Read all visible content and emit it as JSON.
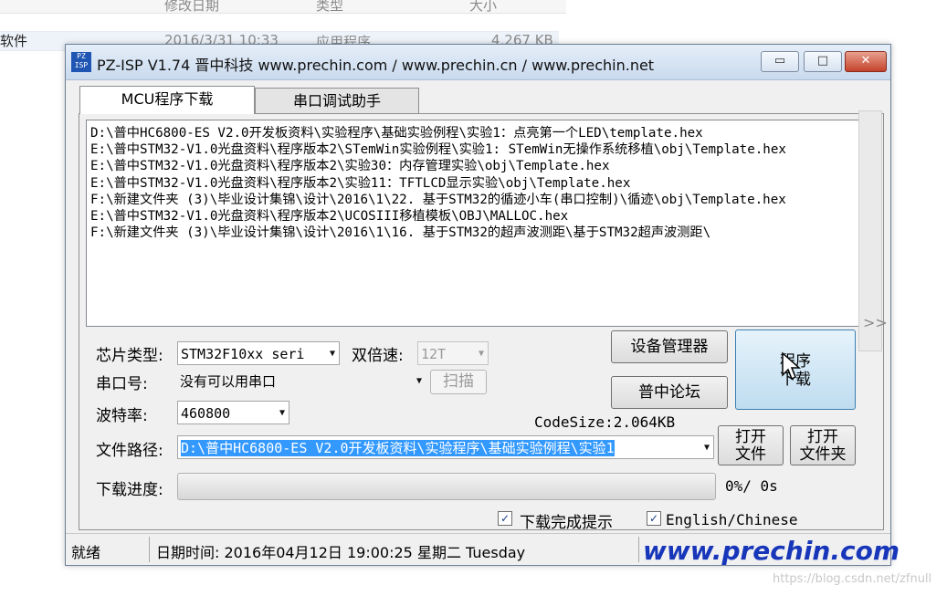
{
  "background": {
    "columns": [
      "修改日期",
      "类型",
      "大小"
    ],
    "left_item": "软件",
    "row": {
      "date": "2016/3/31 10:33",
      "type": "应用程序",
      "size": "4,267 KB"
    }
  },
  "window": {
    "icon_text": "PZ ISP",
    "title": "PZ-ISP V1.74 晋中科技 www.prechin.com / www.prechin.cn / www.prechin.net",
    "controls": {
      "minimize": "▭",
      "restore": "□",
      "close": "✕"
    }
  },
  "tabs": [
    {
      "label": "MCU程序下载",
      "active": true
    },
    {
      "label": "串口调试助手",
      "active": false
    }
  ],
  "history": [
    "D:\\普中HC6800-ES V2.0开发板资料\\实验程序\\基础实验例程\\实验1：点亮第一个LED\\template.hex",
    "E:\\普中STM32-V1.0光盘资料\\程序版本2\\STemWin实验例程\\实验1:  STemWin无操作系统移植\\obj\\Template.hex",
    "E:\\普中STM32-V1.0光盘资料\\程序版本2\\实验30：内存管理实验\\obj\\Template.hex",
    "E:\\普中STM32-V1.0光盘资料\\程序版本2\\实验11：TFTLCD显示实验\\obj\\Template.hex",
    "F:\\新建文件夹 (3)\\毕业设计集锦\\设计\\2016\\1\\22. 基于STM32的循迹小车(串口控制)\\循迹\\obj\\Template.hex",
    "E:\\普中STM32-V1.0光盘资料\\程序版本2\\UCOSIII移植模板\\OBJ\\MALLOC.hex",
    "F:\\新建文件夹 (3)\\毕业设计集锦\\设计\\2016\\1\\16. 基于STM32的超声波测距\\基于STM32超声波测距\\"
  ],
  "form": {
    "chip_label": "芯片类型:",
    "chip_value": "STM32F10xx seri",
    "double_speed_label": "双倍速:",
    "double_speed_value": "12T",
    "port_label": "串口号:",
    "port_value": "没有可以用串口",
    "scan_button": "扫描",
    "baud_label": "波特率:",
    "baud_value": "460800",
    "path_label": "文件路径:",
    "path_value": "D:\\普中HC6800-ES V2.0开发板资料\\实验程序\\基础实验例程\\实验1",
    "code_size": "CodeSize:2.064KB",
    "progress_label": "下载进度:",
    "progress_text": "0%/ 0s",
    "progress_fraction": 0
  },
  "buttons": {
    "device_manager": "设备管理器",
    "forum": "普中论坛",
    "program_line1": "程序",
    "program_line2": "下载",
    "open_file_line1": "打开",
    "open_file_line2": "文件",
    "open_folder_line1": "打开",
    "open_folder_line2": "文件夹"
  },
  "checkboxes": {
    "done_prompt": {
      "label": "下载完成提示",
      "checked": true
    },
    "language": {
      "label": "English/Chinese",
      "checked": true
    }
  },
  "status": {
    "state": "就绪",
    "datetime": "日期时间:   2016年04月12日  19:00:25  星期二  Tuesday",
    "brand": "www.prechin.com"
  },
  "watermark": "https://blog.csdn.net/zfnull",
  "colors": {
    "selection": "#3399ff",
    "brand": "#1736b9"
  }
}
